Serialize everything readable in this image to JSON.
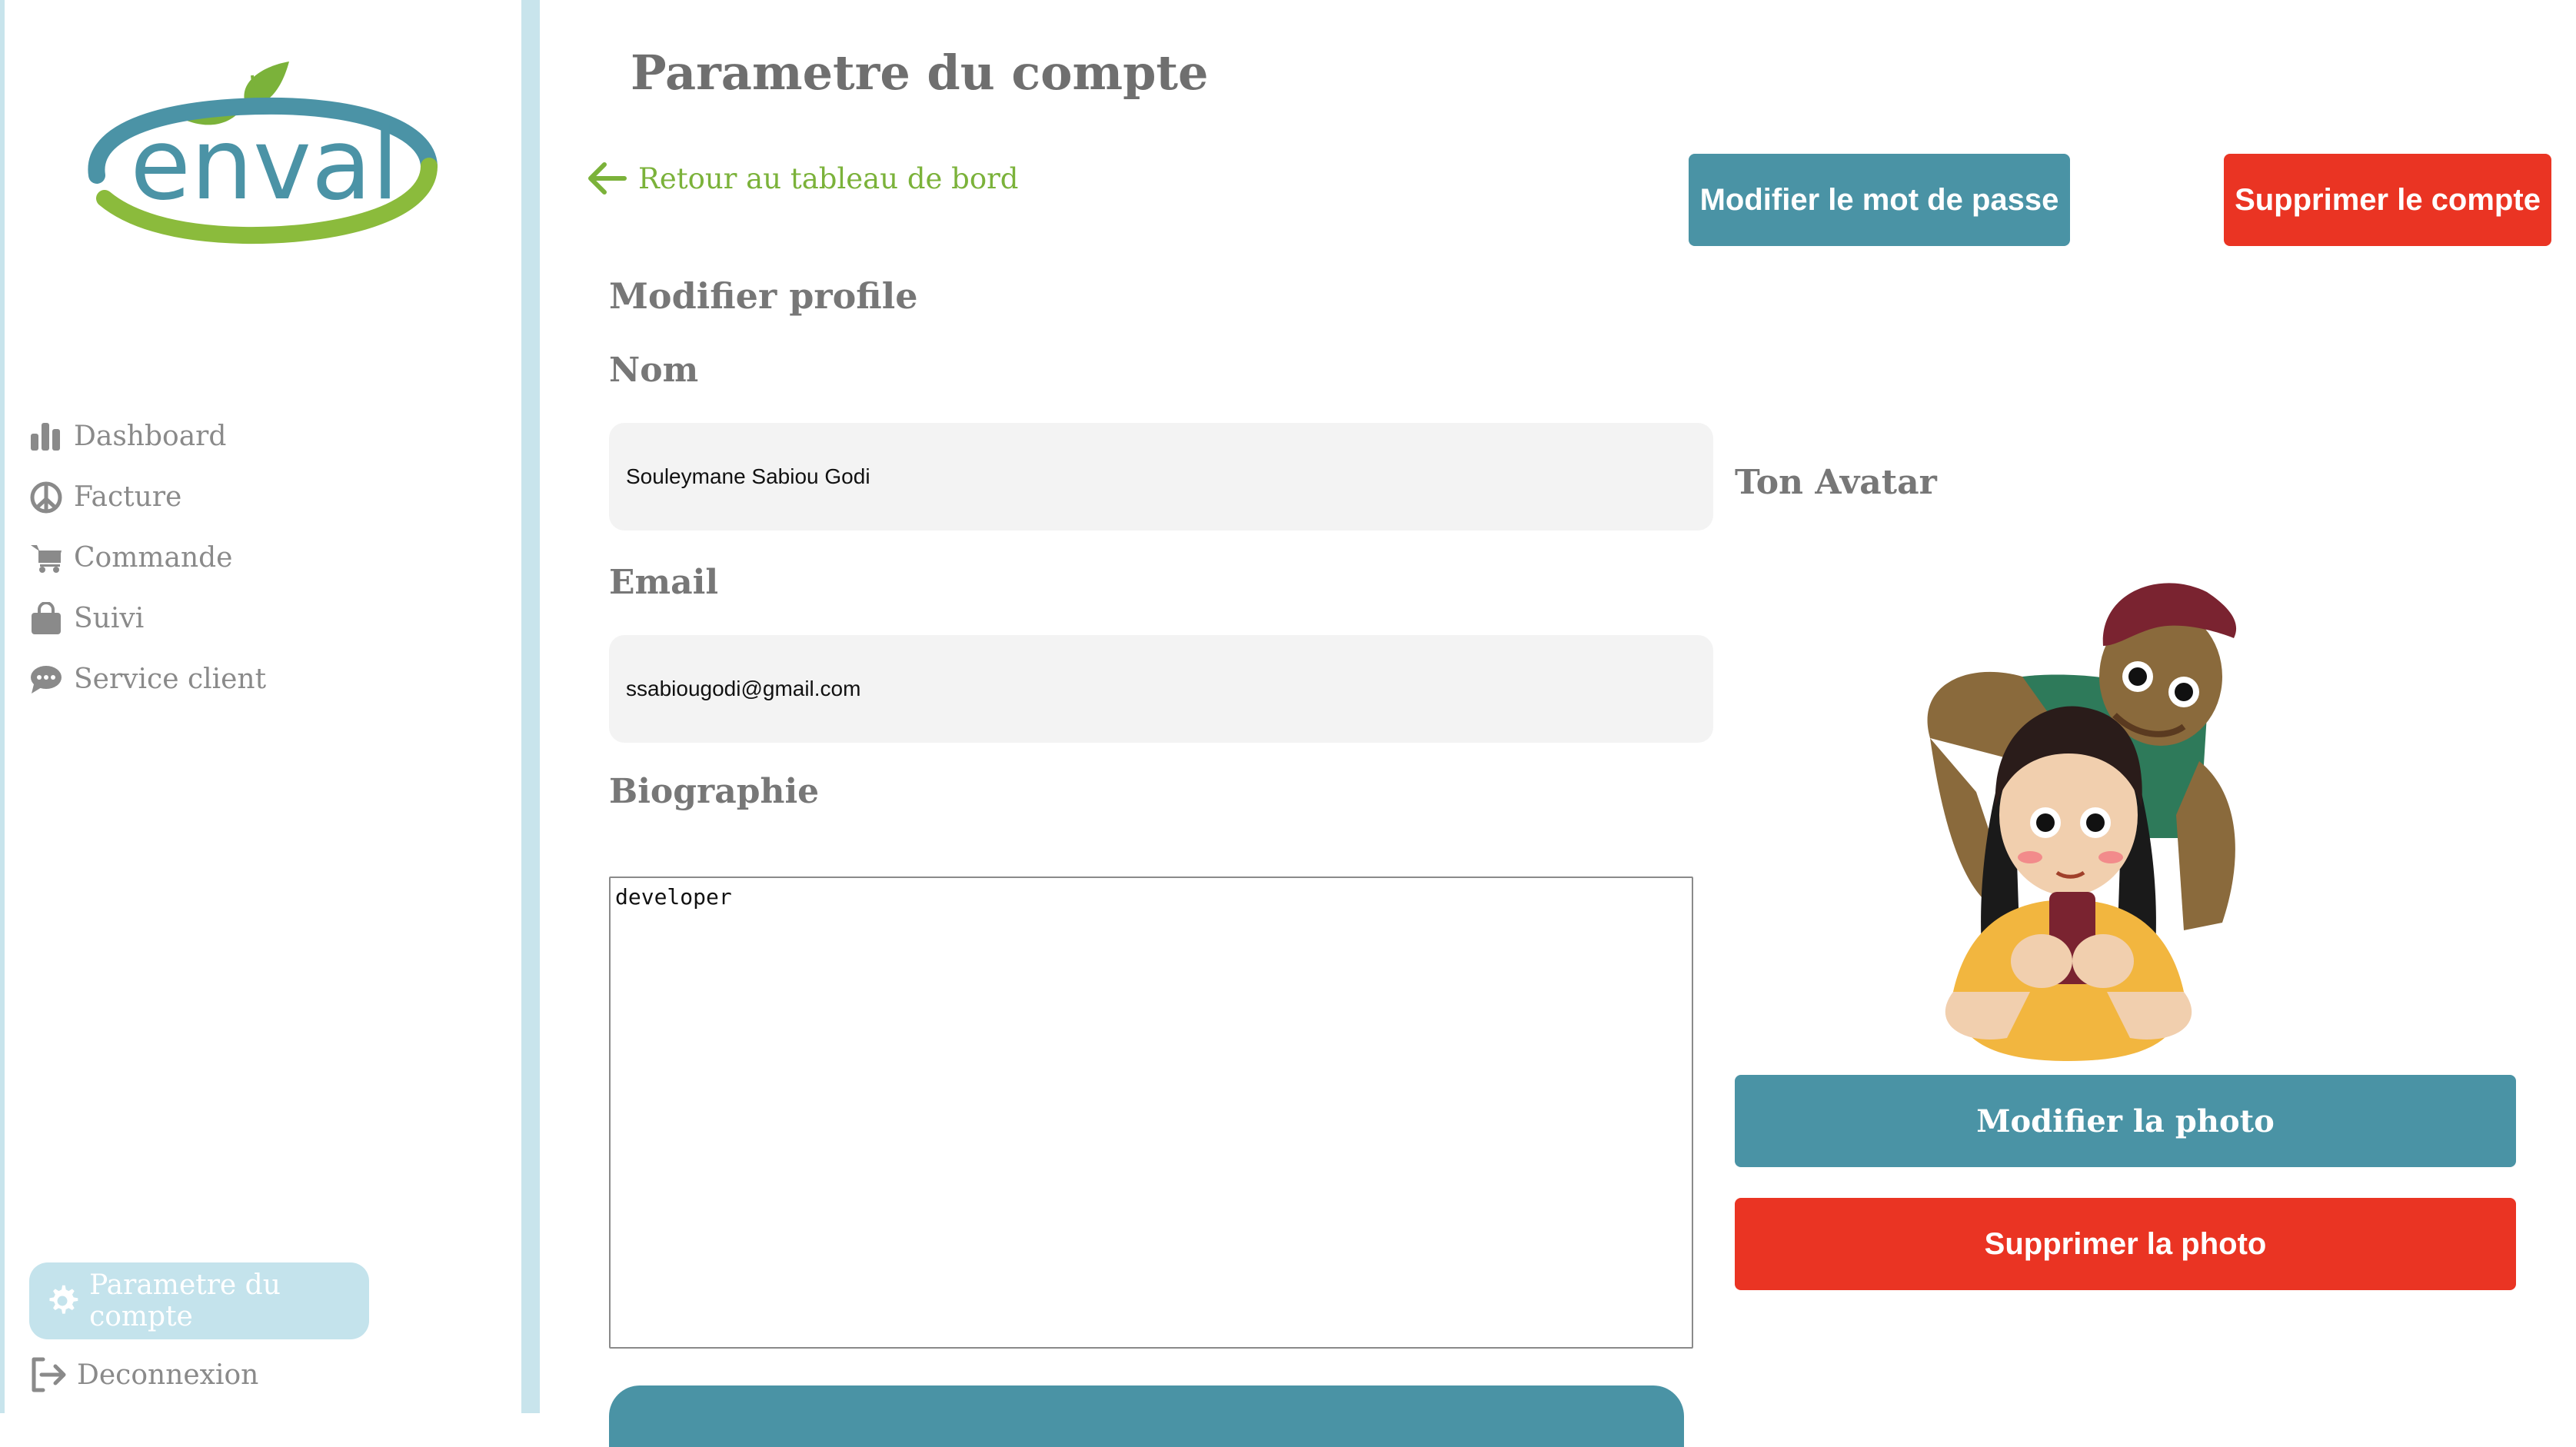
{
  "sidebar": {
    "logo_text": "enval",
    "items": [
      {
        "label": "Dashboard",
        "icon": "bar-chart-icon"
      },
      {
        "label": "Facture",
        "icon": "peace-icon"
      },
      {
        "label": "Commande",
        "icon": "cart-icon"
      },
      {
        "label": "Suivi",
        "icon": "shopping-bag-icon"
      },
      {
        "label": "Service client",
        "icon": "chat-icon"
      }
    ],
    "settings_label": "Parametre du compte",
    "logout_label": "Deconnexion"
  },
  "header": {
    "title": "Parametre du compte",
    "back_label": "Retour au tableau de bord",
    "change_password_label": "Modifier le mot de passe",
    "delete_account_label": "Supprimer le compte"
  },
  "profile": {
    "section_title": "Modifier profile",
    "name_label": "Nom",
    "name_value": "Souleymane Sabiou Godi",
    "email_label": "Email",
    "email_value": "ssabiougodi@gmail.com",
    "bio_label": "Biographie",
    "bio_value": "developer"
  },
  "avatar": {
    "title": "Ton Avatar",
    "change_photo_label": "Modifier la photo",
    "delete_photo_label": "Supprimer la photo"
  },
  "colors": {
    "teal": "#4a93a5",
    "red": "#ea3423",
    "green": "#7bb23a",
    "sidebar_accent": "#c8e4ec"
  }
}
